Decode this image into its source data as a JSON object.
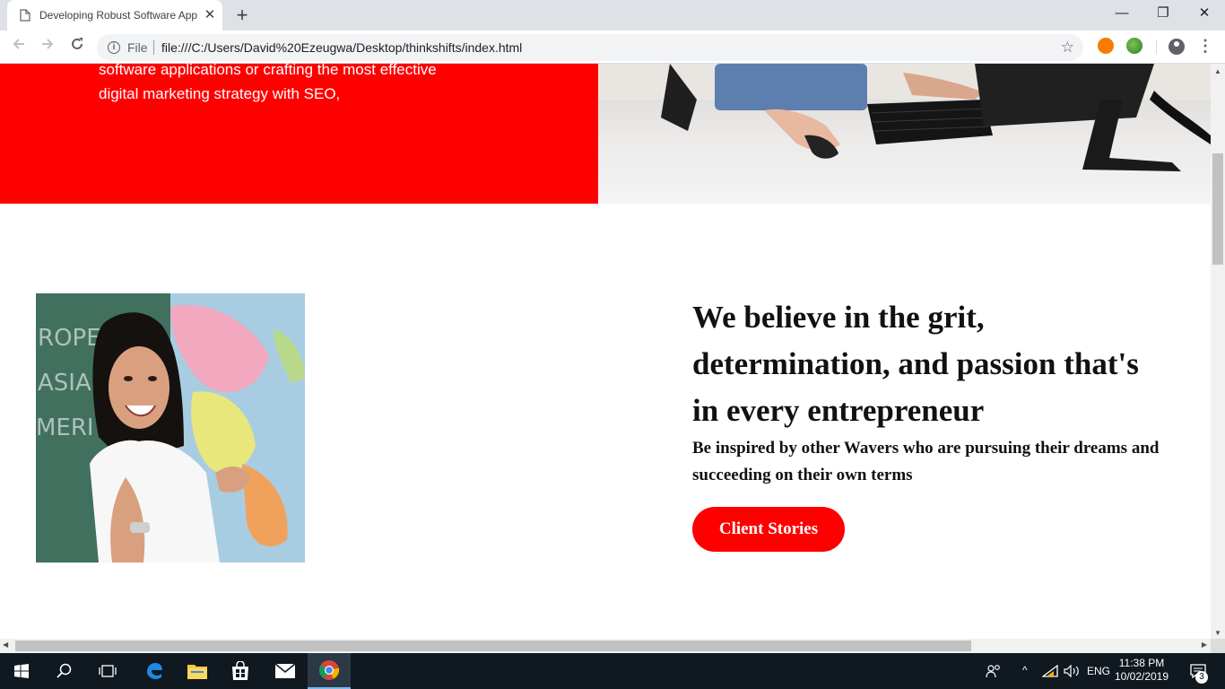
{
  "browser": {
    "tab_title": "Developing Robust Software App",
    "tab_close": "✕",
    "new_tab": "+",
    "scheme_label": "File",
    "url": "file:///C:/Users/David%20Ezeugwa/Desktop/thinkshifts/index.html",
    "window_controls": {
      "minimize": "—",
      "restore": "❐",
      "close": "✕"
    }
  },
  "hero": {
    "lines": [
      "software applications or crafting the most effective",
      "digital marketing strategy with SEO,"
    ]
  },
  "section": {
    "headline_lines": [
      "We believe in the grit,",
      "determination, and passion that's",
      "in every entrepreneur"
    ],
    "subhead": "Be inspired by other Wavers who are pursuing their dreams and succeeding on their own terms",
    "cta_label": "Client Stories",
    "map_labels": [
      "ROPE",
      "ASIA",
      "MERI"
    ]
  },
  "taskbar": {
    "apps": [
      "start-icon",
      "search-icon",
      "task-view-icon",
      "edge-icon",
      "file-explorer-icon",
      "store-icon",
      "mail-icon",
      "chrome-icon"
    ],
    "language": "ENG",
    "time": "11:38 PM",
    "date": "10/02/2019",
    "notification_count": "3"
  },
  "colors": {
    "brand_red": "#ff0000",
    "taskbar": "#101820"
  }
}
